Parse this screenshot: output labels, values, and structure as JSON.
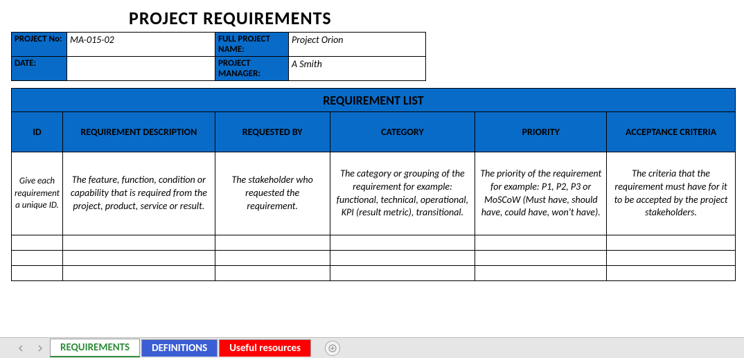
{
  "title": "PROJECT REQUIREMENTS",
  "meta": {
    "project_no_label": "PROJECT No:",
    "project_no_value": "MA-015-02",
    "full_name_label": "FULL PROJECT NAME:",
    "full_name_value": "Project Orion",
    "date_label": "DATE:",
    "date_value": "",
    "pm_label": "PROJECT MANAGER:",
    "pm_value": "A Smith"
  },
  "list_header": "REQUIREMENT LIST",
  "columns": {
    "id": "ID",
    "desc": "REQUIREMENT DESCRIPTION",
    "reqby": "REQUESTED BY",
    "cat": "CATEGORY",
    "priority": "PRIORITY",
    "accept": "ACCEPTANCE CRITERIA"
  },
  "guidance": {
    "id": "Give each requirement a unique ID.",
    "desc": "The feature, function, condition or capability that is required from the project, product, service or result.",
    "reqby": "The stakeholder who requested the requirement.",
    "cat": "The category or grouping of the requirement for example: functional, technical, operational, KPI (result metric), transitional.",
    "priority": "The priority of the requirement for example: P1, P2, P3 or MoSCoW (Must have, should have, could have, won't have).",
    "accept": "The criteria that the requirement must have for it to be accepted by the project stakeholders."
  },
  "tabs": {
    "requirements": "REQUIREMENTS",
    "definitions": "DEFINITIONS",
    "useful": "Useful resources"
  }
}
